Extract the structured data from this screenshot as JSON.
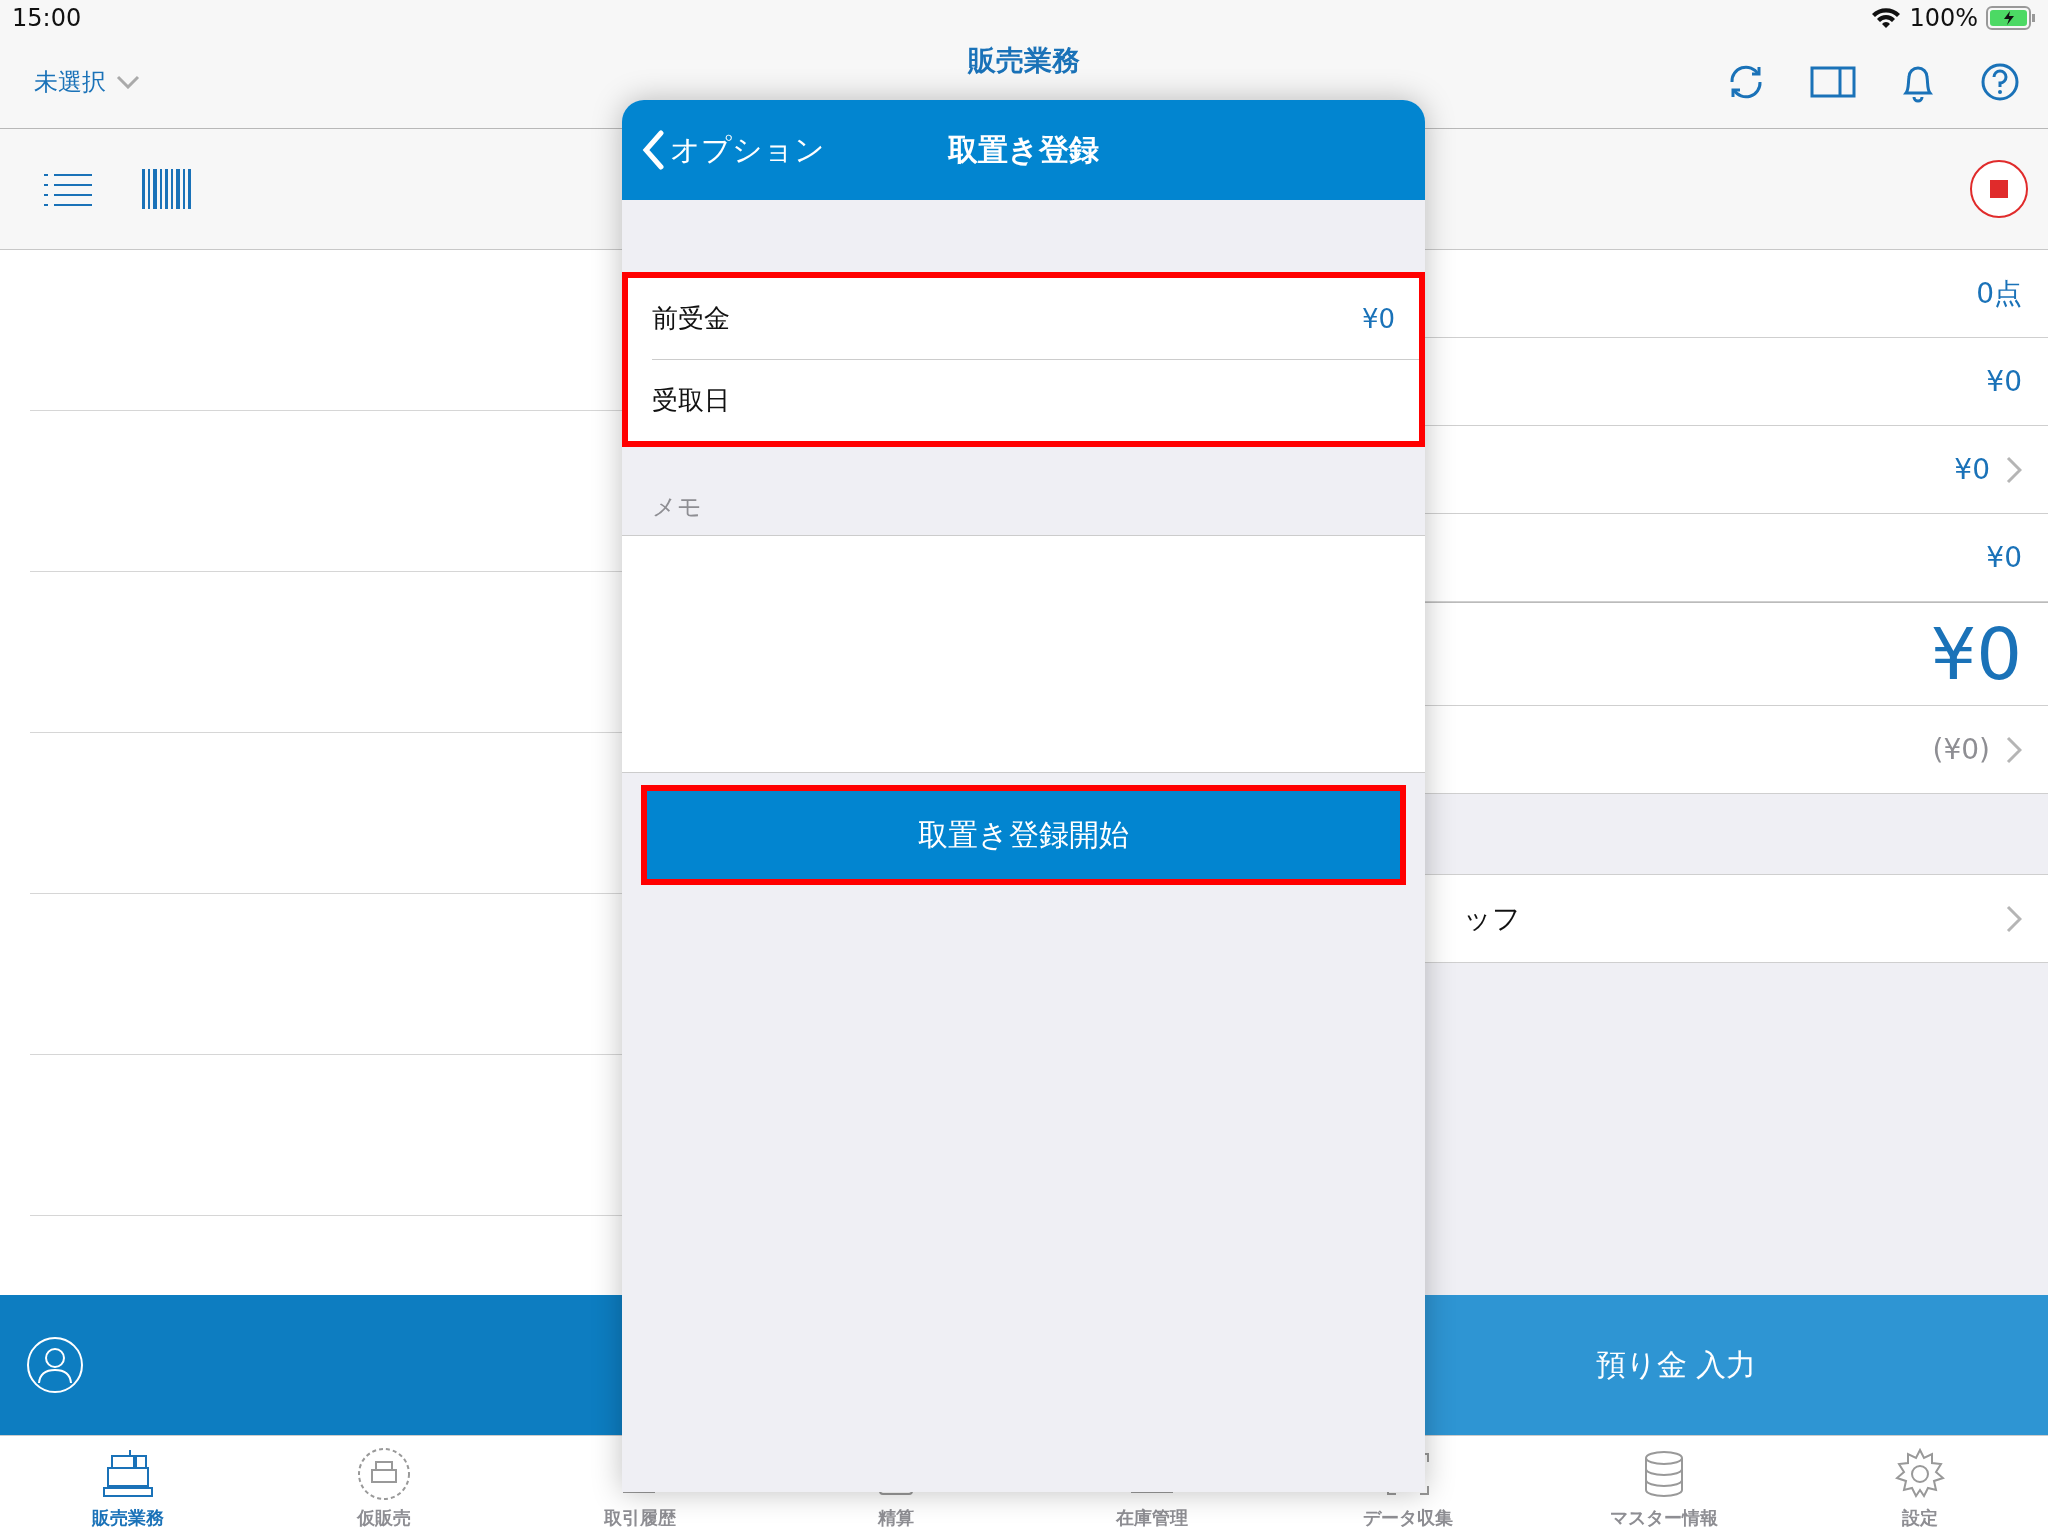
{
  "status_bar": {
    "time": "15:00",
    "battery": "100%"
  },
  "nav": {
    "store_selector": "未選択",
    "title": "販売業務"
  },
  "right_panel": {
    "rows": [
      {
        "kind": "value",
        "value": "0点",
        "chevron": false
      },
      {
        "kind": "value",
        "value": "¥0",
        "chevron": false
      },
      {
        "kind": "value",
        "value": "¥0",
        "chevron": true
      },
      {
        "kind": "value",
        "value": "¥0",
        "chevron": false
      },
      {
        "kind": "total",
        "value": "¥0"
      },
      {
        "kind": "muted",
        "value": "(¥0)",
        "chevron": true
      },
      {
        "kind": "spacer"
      },
      {
        "kind": "label",
        "label": "ッフ",
        "chevron": true
      }
    ]
  },
  "action_bar": {
    "button": "預り金 入力"
  },
  "tabs": [
    {
      "label": "販売業務",
      "selected": true
    },
    {
      "label": "仮販売",
      "selected": false
    },
    {
      "label": "取引履歴",
      "selected": false
    },
    {
      "label": "精算",
      "selected": false
    },
    {
      "label": "在庫管理",
      "selected": false
    },
    {
      "label": "データ収集",
      "selected": false
    },
    {
      "label": "マスター情報",
      "selected": false
    },
    {
      "label": "設定",
      "selected": false
    }
  ],
  "modal": {
    "back": "オプション",
    "title": "取置き登録",
    "fields": [
      {
        "label": "前受金",
        "value": "¥0"
      },
      {
        "label": "受取日"
      }
    ],
    "memo_header": "メモ",
    "submit": "取置き登録開始"
  }
}
